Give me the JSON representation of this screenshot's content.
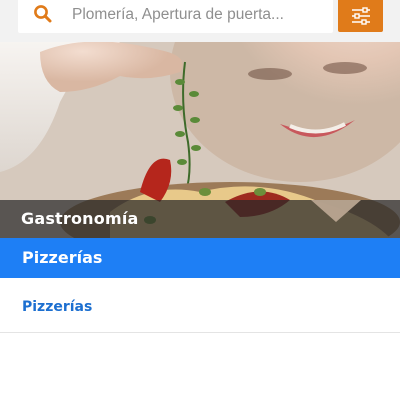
{
  "search": {
    "placeholder": "Plomería, Apertura de puerta...",
    "icon": "search-icon",
    "icon_color": "#e07b1a"
  },
  "filter": {
    "icon": "sliders-icon",
    "background": "#e07b1a"
  },
  "hero": {
    "caption": "Gastronomía"
  },
  "category": {
    "title": "Pizzerías",
    "background": "#1e7ff5"
  },
  "list": {
    "items": [
      {
        "label": "Pizzerías"
      }
    ],
    "text_color": "#1c6fd0"
  }
}
